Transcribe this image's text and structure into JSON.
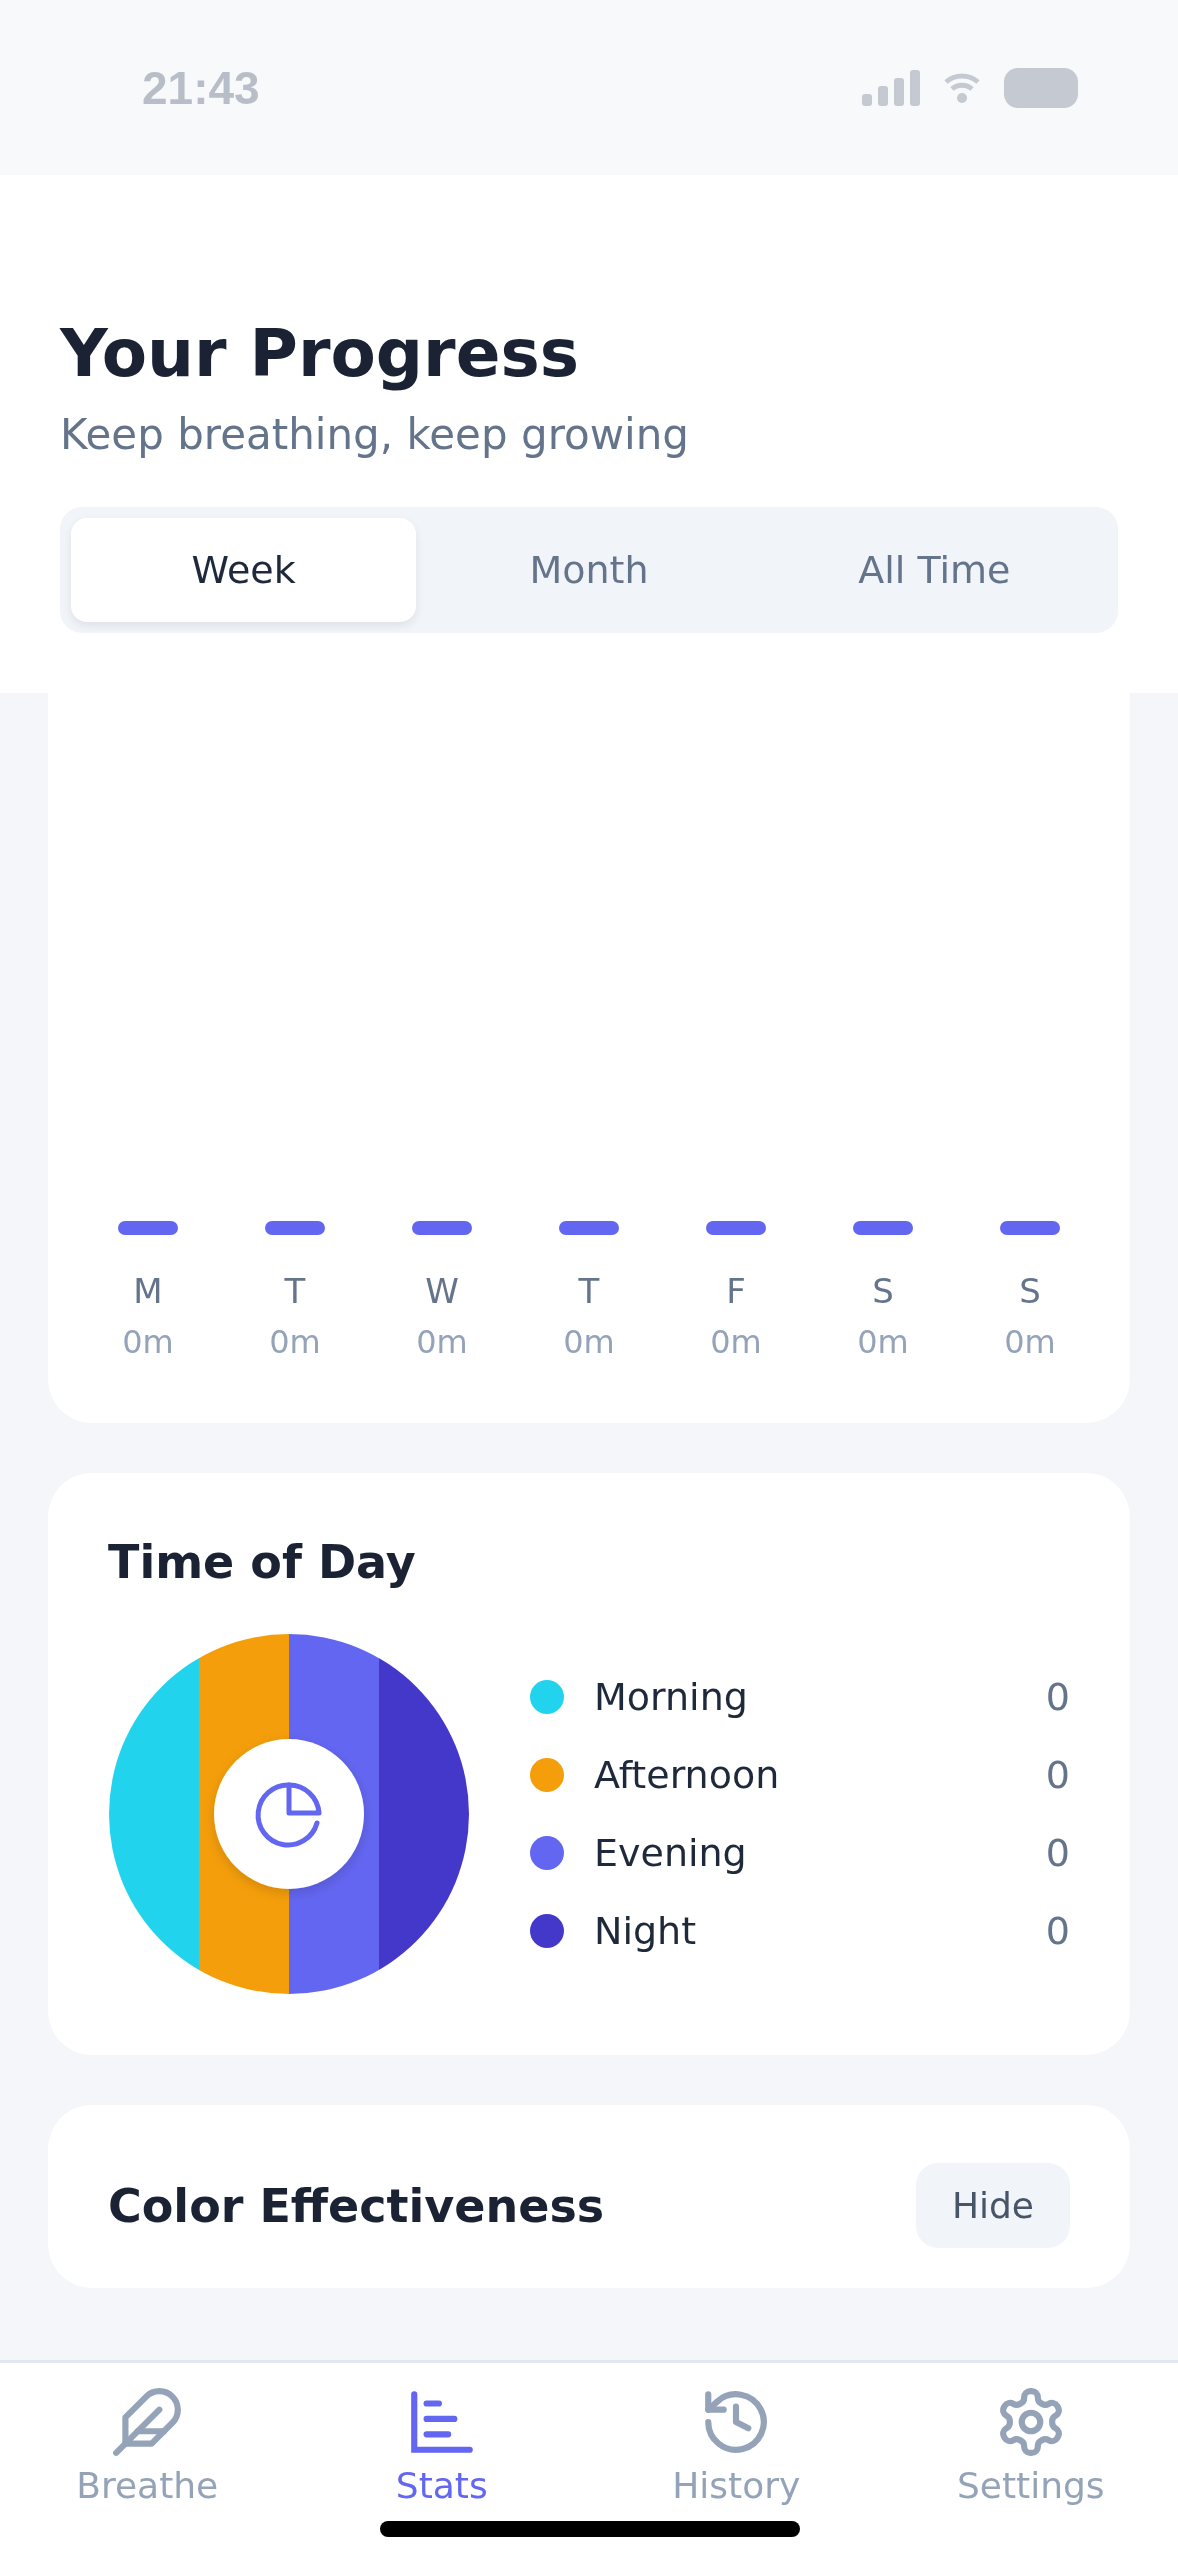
{
  "status_bar": {
    "time": "21:43"
  },
  "header": {
    "title": "Your Progress",
    "subtitle": "Keep breathing, keep growing"
  },
  "tabs": [
    {
      "label": "Week",
      "selected": true
    },
    {
      "label": "Month",
      "selected": false
    },
    {
      "label": "All Time",
      "selected": false
    }
  ],
  "weekly": {
    "days": [
      {
        "label": "M",
        "minutes": "0m"
      },
      {
        "label": "T",
        "minutes": "0m"
      },
      {
        "label": "W",
        "minutes": "0m"
      },
      {
        "label": "T",
        "minutes": "0m"
      },
      {
        "label": "F",
        "minutes": "0m"
      },
      {
        "label": "S",
        "minutes": "0m"
      },
      {
        "label": "S",
        "minutes": "0m"
      }
    ]
  },
  "time_of_day": {
    "title": "Time of Day",
    "items": [
      {
        "label": "Morning",
        "value": "0",
        "color": "#22d3ee"
      },
      {
        "label": "Afternoon",
        "value": "0",
        "color": "#f59e0b"
      },
      {
        "label": "Evening",
        "value": "0",
        "color": "#6366f1"
      },
      {
        "label": "Night",
        "value": "0",
        "color": "#4338ca"
      }
    ]
  },
  "color_effectiveness": {
    "title": "Color Effectiveness",
    "button": "Hide"
  },
  "nav": [
    {
      "label": "Breathe",
      "kind": "feather",
      "selected": false
    },
    {
      "label": "Stats",
      "kind": "chart",
      "selected": true
    },
    {
      "label": "History",
      "kind": "history",
      "selected": false
    },
    {
      "label": "Settings",
      "kind": "gear",
      "selected": false
    }
  ]
}
